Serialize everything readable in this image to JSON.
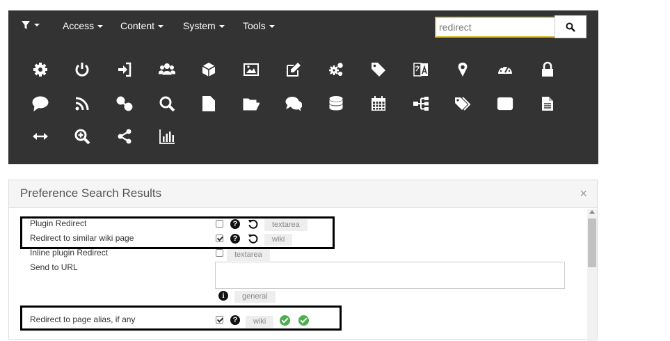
{
  "navbar": {
    "items": [
      {
        "label": "Access"
      },
      {
        "label": "Content"
      },
      {
        "label": "System"
      },
      {
        "label": "Tools"
      }
    ],
    "search_value": "redirect"
  },
  "icon_grid": [
    [
      "gear-icon",
      "power-icon",
      "sign-in-icon",
      "users-icon",
      "cube-icon",
      "image-icon",
      "edit-icon",
      "cogs-icon",
      "tag-icon",
      "language-icon",
      "map-marker-icon",
      "dashboard-icon",
      "lock-icon"
    ],
    [
      "comment-icon",
      "rss-icon",
      "link-icon",
      "search-icon",
      "file-text-icon",
      "folder-open-icon",
      "comments-icon",
      "database-icon",
      "calendar-icon",
      "sitemap-icon",
      "tags-icon",
      "envelope-icon",
      "file-icon"
    ],
    [
      "arrows-h-icon",
      "zoom-in-icon",
      "share-icon",
      "bar-chart-icon"
    ]
  ],
  "panel": {
    "title": "Preference Search Results",
    "close": "×"
  },
  "prefs": [
    {
      "label": "Plugin Redirect",
      "checked": false,
      "tag": "textarea"
    },
    {
      "label": "Redirect to similar wiki page",
      "checked": true,
      "tag": "wiki"
    },
    {
      "label": "Inline plugin Redirect",
      "checked": false,
      "tag": "textarea"
    },
    {
      "label": "Send to URL",
      "tag": "general"
    },
    {
      "label": "Redirect to page alias, if any",
      "checked": true,
      "tag": "wiki"
    }
  ]
}
